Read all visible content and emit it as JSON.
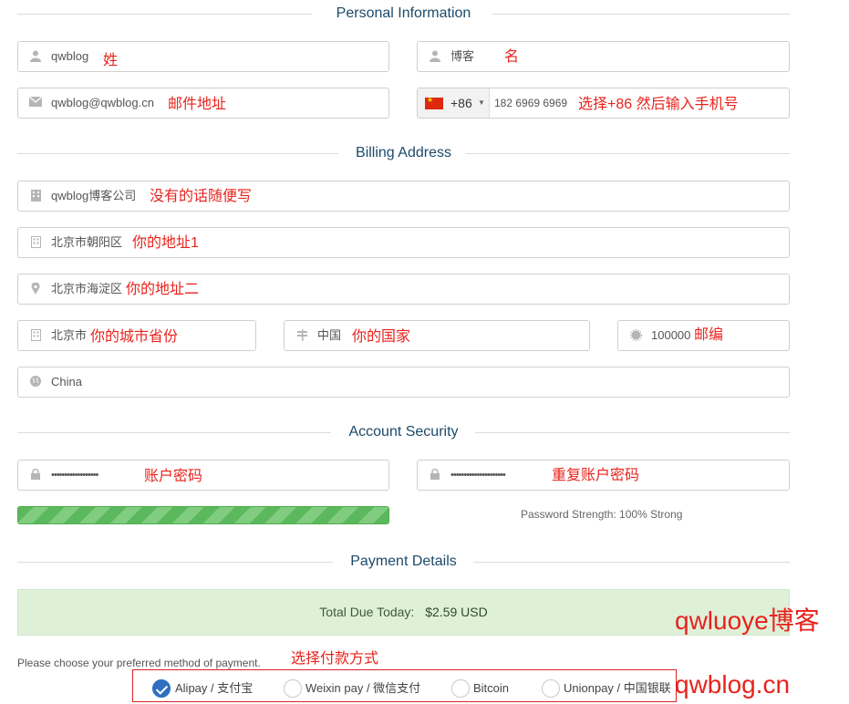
{
  "sections": {
    "personal": "Personal Information",
    "billing": "Billing Address",
    "security": "Account Security",
    "payment": "Payment Details"
  },
  "personal": {
    "first_name": "qwblog",
    "first_name_note": "姓",
    "last_name": "博客",
    "last_name_note": "名",
    "email": "qwblog@qwblog.cn",
    "email_note": "邮件地址",
    "phone_code": "+86",
    "phone": "182 6969 6969",
    "phone_note": "选择+86 然后输入手机号"
  },
  "billing": {
    "company": "qwblog博客公司",
    "company_note": "没有的话随便写",
    "address1": "北京市朝阳区",
    "address1_note": "你的地址1",
    "address2": "北京市海淀区",
    "address2_note": "你的地址二",
    "city": "北京市",
    "city_note": "你的城市省份",
    "state": "中国",
    "state_note": "你的国家",
    "postcode": "100000",
    "postcode_note": "邮编",
    "country": "China"
  },
  "security": {
    "password": "••••••••••••••••••",
    "password_note": "账户密码",
    "confirm": "•••••••••••••••••••••",
    "confirm_note": "重复账户密码",
    "strength_label": "Password Strength: 100% Strong",
    "strength_value": 1.0
  },
  "payment": {
    "due_label": "Total Due Today:",
    "due_amount": "$2.59 USD",
    "choose_text": "Please choose your preferred method of payment.",
    "choose_note": "选择付款方式",
    "methods": [
      "Alipay / 支付宝",
      "Weixin pay / 微信支付",
      "Bitcoin",
      "Unionpay / 中国银联"
    ],
    "selected": 0
  },
  "watermark": {
    "line1": "qwluoye博客",
    "line2": "qwblog.cn"
  },
  "colors": {
    "annotation": "#e8231d",
    "heading": "#1c4a6a",
    "selected_radio": "#2e6fbf"
  }
}
